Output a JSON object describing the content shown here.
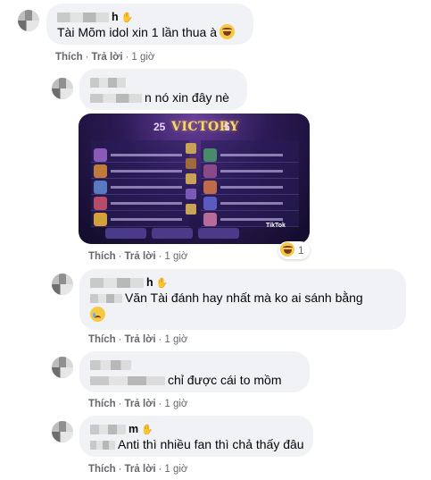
{
  "comments": [
    {
      "author_suffix": "h",
      "text": "Tài Mõm idol xin 1 lần thua à",
      "emoji": "laughing-tears-emoji",
      "actions": {
        "like": "Thích",
        "reply": "Trả lời",
        "time": "1 giờ"
      }
    },
    {
      "author_suffix": "",
      "text": "n nó xin đây nè",
      "actions": {
        "like": "Thích",
        "reply": "Trả lời",
        "time": "1 giờ"
      },
      "image": {
        "score_left": "25",
        "title": "VICTORY",
        "score_right": "5",
        "watermark": "TikTok"
      },
      "reaction_count": "1"
    },
    {
      "author_suffix": "h",
      "text": "Văn Tài đánh hay nhất mà ko ai sánh bằng",
      "emoji": "crying-emoji",
      "actions": {
        "like": "Thích",
        "reply": "Trả lời",
        "time": "1 giờ"
      }
    },
    {
      "author_suffix": "",
      "text": "chỉ được cái to mồm",
      "actions": {
        "like": "Thích",
        "reply": "Trả lời",
        "time": "1 giờ"
      }
    },
    {
      "author_suffix": "m",
      "text": "Anti thì nhiều fan thì chả thấy đâu",
      "actions": {
        "like": "Thích",
        "reply": "Trả lời",
        "time": "1 giờ"
      }
    }
  ],
  "colors": {
    "bubble_bg": "#f0f2f5",
    "secondary_text": "#65676b",
    "primary_text": "#050505"
  }
}
